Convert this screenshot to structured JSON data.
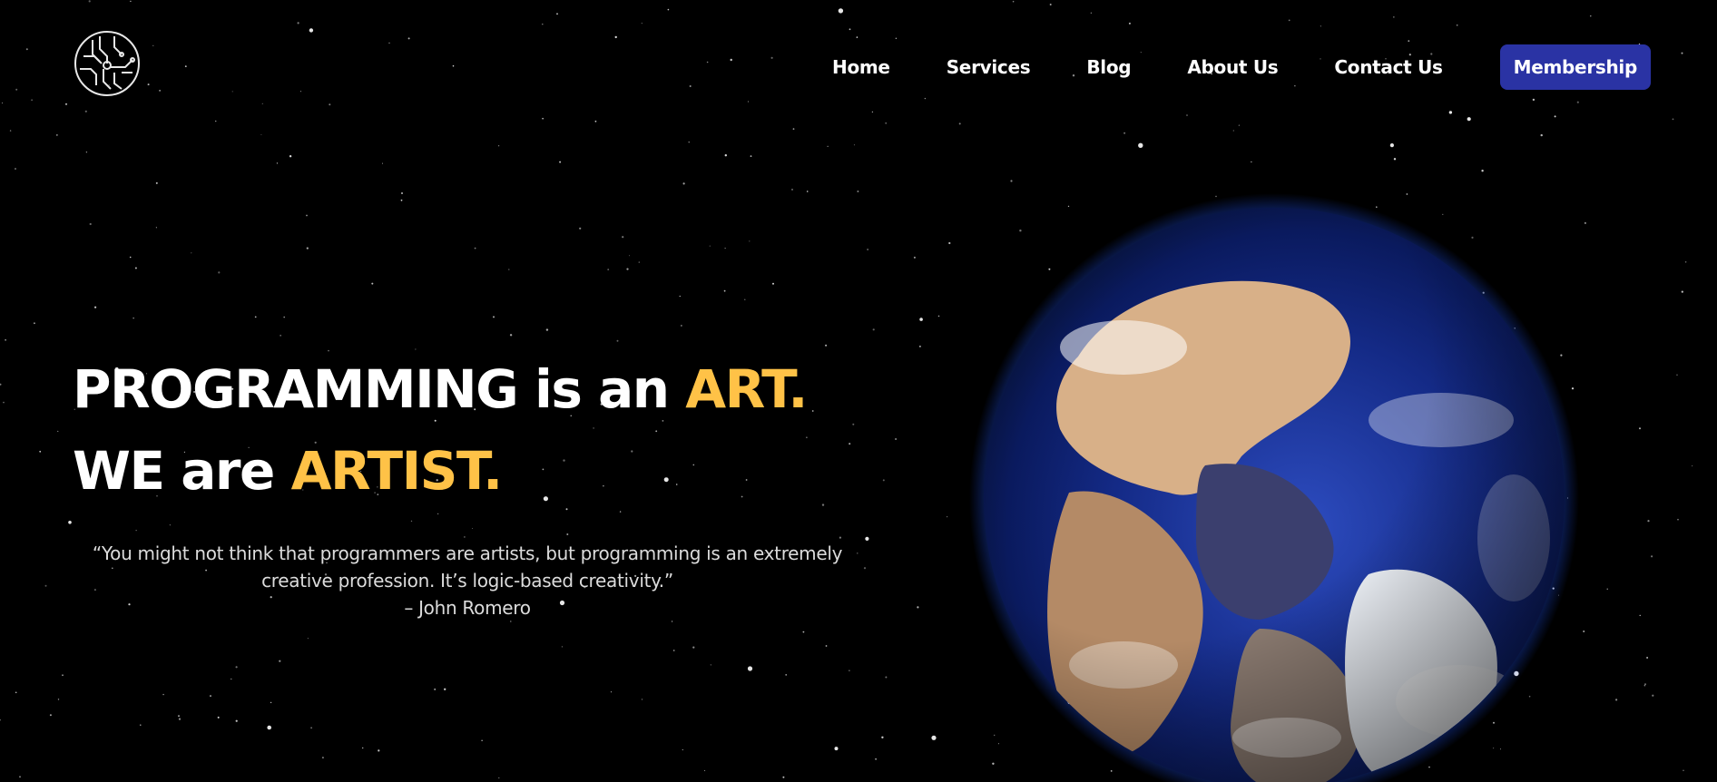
{
  "nav": {
    "home": "Home",
    "services": "Services",
    "blog": "Blog",
    "about": "About Us",
    "contact": "Contact Us",
    "membership": "Membership"
  },
  "hero": {
    "line1_white": "PROGRAMMING is an ",
    "line1_accent": "ART.",
    "line2_white": "WE are ",
    "line2_accent": "ARTIST."
  },
  "quote": {
    "text": "“You might not think that programmers are artists, but programming is an extremely creative profession. It’s logic-based creativity.”",
    "author": "– John Romero"
  },
  "colors": {
    "background": "#000000",
    "accent": "#ffc247",
    "button": "#2a33a4",
    "text": "#ffffff"
  },
  "icons": {
    "logo": "circuit-circle-logo",
    "earth": "earth-globe-image"
  }
}
